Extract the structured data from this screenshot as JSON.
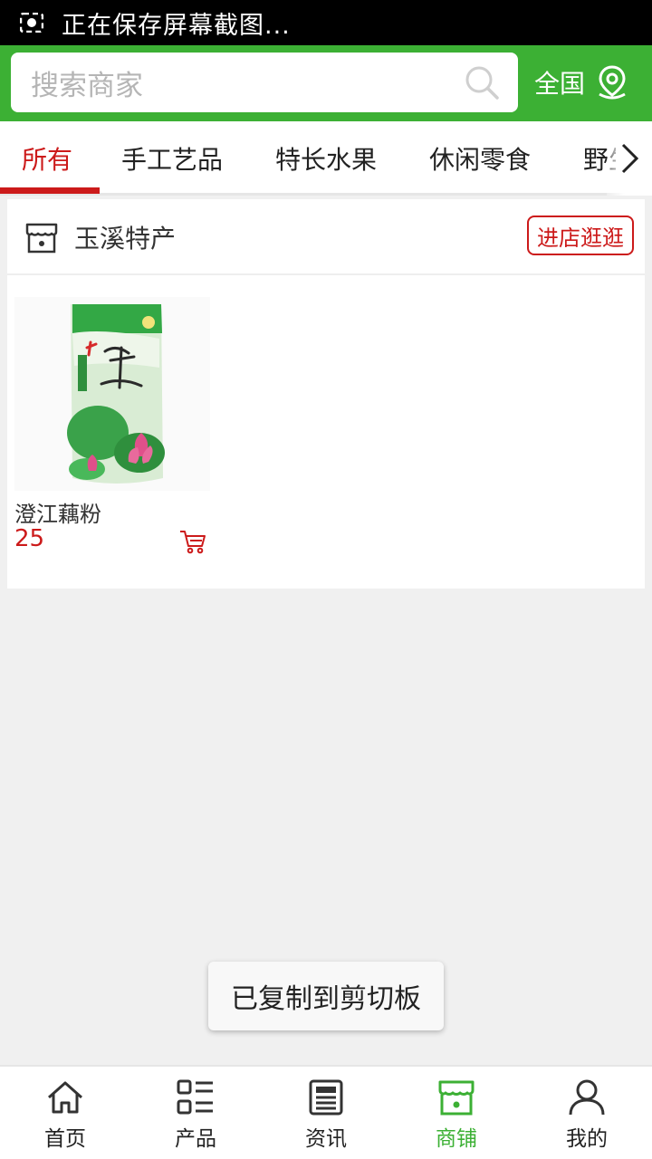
{
  "status_bar": {
    "text": "正在保存屏幕截图..."
  },
  "search": {
    "placeholder": "搜索商家"
  },
  "region": {
    "label": "全国"
  },
  "categories": {
    "items": [
      {
        "label": "所有",
        "active": true
      },
      {
        "label": "手工艺品",
        "active": false
      },
      {
        "label": "特长水果",
        "active": false
      },
      {
        "label": "休闲零食",
        "active": false
      },
      {
        "label": "野生菌",
        "active": false
      }
    ]
  },
  "shop": {
    "name": "玉溪特产",
    "enter_label": "进店逛逛",
    "products": [
      {
        "name": "澄江藕粉",
        "price": "25"
      }
    ]
  },
  "toast": {
    "text": "已复制到剪切板"
  },
  "bottom_nav": {
    "items": [
      {
        "label": "首页",
        "icon": "home-icon",
        "active": false
      },
      {
        "label": "产品",
        "icon": "product-list-icon",
        "active": false
      },
      {
        "label": "资讯",
        "icon": "news-icon",
        "active": false
      },
      {
        "label": "商铺",
        "icon": "shop-icon",
        "active": true
      },
      {
        "label": "我的",
        "icon": "user-icon",
        "active": false
      }
    ]
  },
  "colors": {
    "brand_green": "#3cb034",
    "accent_red": "#cc1a1a"
  }
}
